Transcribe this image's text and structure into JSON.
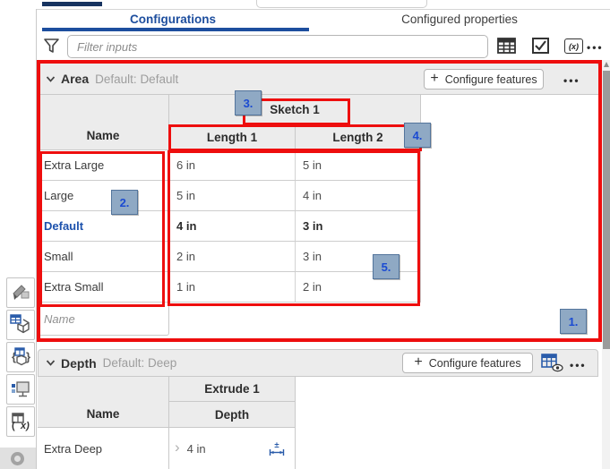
{
  "tabs": {
    "configurations": "Configurations",
    "configured_properties": "Configured properties"
  },
  "filter": {
    "placeholder": "Filter inputs"
  },
  "toolbar": {
    "variable_glyph": "(x)",
    "more_glyph": "•••"
  },
  "icons": {
    "plus": "+",
    "row_chevron": "›",
    "plus_minus": "±"
  },
  "area": {
    "title": "Area",
    "default_prefix": "Default:",
    "default_value": "Default",
    "configure_label": "Configure features",
    "more_glyph": "•••",
    "table": {
      "name_header": "Name",
      "feature_header": "Sketch 1",
      "param_headers": [
        "Length 1",
        "Length 2"
      ],
      "rows": [
        {
          "name": "Extra Large",
          "v1": "6 in",
          "v2": "5 in"
        },
        {
          "name": "Large",
          "v1": "5 in",
          "v2": "4 in"
        },
        {
          "name": "Default",
          "v1": "4 in",
          "v2": "3 in"
        },
        {
          "name": "Small",
          "v1": "2 in",
          "v2": "3 in"
        },
        {
          "name": "Extra Small",
          "v1": "1 in",
          "v2": "2 in"
        }
      ],
      "new_row_placeholder": "Name"
    }
  },
  "depth": {
    "title": "Depth",
    "default_prefix": "Default:",
    "default_value": "Deep",
    "configure_label": "Configure features",
    "more_glyph": "•••",
    "table": {
      "name_header": "Name",
      "feature_header": "Extrude 1",
      "param_header": "Depth",
      "rows": [
        {
          "name": "Extra Deep",
          "v1": "4 in"
        }
      ]
    }
  },
  "annotations": {
    "n1": "1.",
    "n2": "2.",
    "n3": "3.",
    "n4": "4.",
    "n5": "5."
  },
  "colors": {
    "accent_blue": "#1d4e9e",
    "default_row_blue": "#1d52ad",
    "annotation_red": "#ee0e0e",
    "callout_bg": "#8fa9c4",
    "callout_border": "#53759c",
    "callout_text": "#1b4bd2",
    "header_gray": "#ececec",
    "border_gray": "#c9c9c9"
  }
}
